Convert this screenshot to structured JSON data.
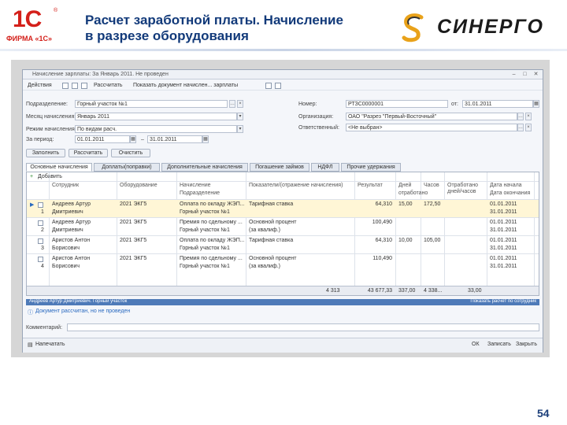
{
  "header": {
    "logo_1c": "1С",
    "logo_firma": "ФИРМА «1С»",
    "title_line1": "Расчет заработной платы. Начисление",
    "title_line2": "в разрезе оборудования",
    "brand": "СИНЕРГО"
  },
  "window": {
    "title": "Начисление зарплаты: За Январь 2011. Не проведен",
    "toolbar": {
      "actions": "Действия",
      "recalc": "Рассчитать",
      "show_doc": "Показать документ начислен... зарплаты"
    },
    "form": {
      "podrazdelenie_label": "Подразделение:",
      "podrazdelenie_value": "Горный участок №1",
      "mesyac_label": "Месяц начисления:",
      "mesyac_value": "Январь 2011",
      "rezhim_label": "Режим начисления:",
      "rezhim_value": "По видам расч.",
      "za_period_label": "За период:",
      "period_from": "01.01.2011",
      "period_to": "31.01.2011",
      "nomer_label": "Номер:",
      "nomer_value": "РТЗС0000001",
      "ot_label": "от:",
      "data_value": "31.01.2011",
      "org_label": "Организация:",
      "org_value": "ОАО \"Разрез \"Первый-Восточный\"",
      "otvetstv_label": "Ответственный:",
      "otvetstv_value": "<Не выбран>"
    },
    "buttons": {
      "zapolnit": "Заполнить",
      "rasschitat": "Рассчитать",
      "ochistit": "Очистить"
    },
    "tabs": [
      "Основные начисления",
      "Доплаты(поправки)",
      "Дополнительные начисления",
      "Погашение займов",
      "НДФЛ",
      "Прочие удержания"
    ],
    "grid": {
      "add": "Добавить",
      "headers": {
        "col1": "Сотрудник",
        "col2": "Оборудование",
        "col3": "Начисление",
        "col3b": "Подразделение",
        "col4": "Показатели/(отражение начисления)",
        "col5": "Результат",
        "col6": "Дней",
        "col6b": "отработано",
        "col7": "Часов",
        "col8": "Отработано дней/часов",
        "col9": "Дата начала",
        "col9b": "Дата окончания"
      },
      "rows": [
        {
          "num": "1",
          "emp1": "Андреев Артур",
          "emp2": "Дмитриевич",
          "eq": "2021 ЭКГ5",
          "nach1": "Оплата по окладу ЖЭП...",
          "nach2": "Горный участок №1",
          "pok": "Тарифная ставка",
          "res": "64,310",
          "days": "15,00",
          "hours": "172,50",
          "d1": "01.01.2011",
          "d2": "31.01.2011"
        },
        {
          "num": "2",
          "emp1": "Андреев Артур",
          "emp2": "Дмитриевич",
          "eq": "2021 ЭКГ5",
          "nach1": "Премия по сдельному ...",
          "nach2": "Горный участок №1",
          "pok": "Основной процент",
          "pok2": "(за квалиф.)",
          "res": "100,490",
          "days": "",
          "hours": "",
          "d1": "01.01.2011",
          "d2": "31.01.2011"
        },
        {
          "num": "3",
          "emp1": "Аристов Антон",
          "emp2": "Борисович",
          "eq": "2021 ЭКГ5",
          "nach1": "Оплата по окладу ЖЭП...",
          "nach2": "Горный участок №1",
          "pok": "Тарифная ставка",
          "res": "64,310",
          "days": "10,00",
          "hours": "105,00",
          "d1": "01.01.2011",
          "d2": "31.01.2011"
        },
        {
          "num": "4",
          "emp1": "Аристов Антон",
          "emp2": "Борисович",
          "eq": "2021 ЭКГ5",
          "nach1": "Премия по сдельному ...",
          "nach2": "Горный участок №1",
          "pok": "Основной процент",
          "pok2": "(за квалиф.)",
          "res": "110,490",
          "days": "",
          "hours": "",
          "d1": "01.01.2011",
          "d2": "31.01.2011"
        }
      ],
      "totals": {
        "pok": "4 313",
        "res": "43 677,33",
        "days": "337,00",
        "hours": "4 338...",
        "otr": "33,00"
      }
    },
    "infobar": {
      "left": "Андреев Артур Дмитриевич. Горный участок",
      "right": "Показать расчет по сотрудник"
    },
    "status": "Документ рассчитан, но не проведен",
    "comment_label": "Комментарий:",
    "bottom": {
      "print": "Напечатать",
      "ok": "ОК",
      "save": "Записать",
      "close": "Закрыть"
    }
  },
  "page_number": "54"
}
